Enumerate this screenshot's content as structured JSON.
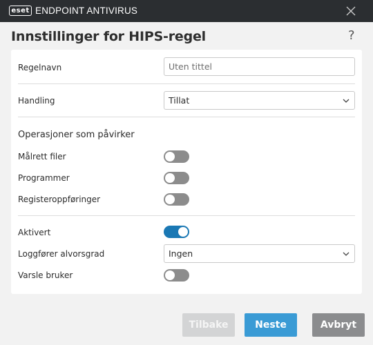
{
  "titlebar": {
    "logo_badge": "eset",
    "app_name": "ENDPOINT ANTIVIRUS"
  },
  "header": {
    "title": "Innstillinger for HIPS-regel",
    "help": "?"
  },
  "form": {
    "rule_name": {
      "label": "Regelnavn",
      "placeholder": "Uten tittel"
    },
    "action": {
      "label": "Handling",
      "value": "Tillat"
    },
    "operations_heading": "Operasjoner som påvirker",
    "target_files": {
      "label": "Målrett filer",
      "enabled": false
    },
    "applications": {
      "label": "Programmer",
      "enabled": false
    },
    "registry_entries": {
      "label": "Registeroppføringer",
      "enabled": false
    },
    "enabled": {
      "label": "Aktivert",
      "enabled": true
    },
    "logging_severity": {
      "label": "Loggfører alvorsgrad",
      "value": "Ingen"
    },
    "notify_user": {
      "label": "Varsle bruker",
      "enabled": false
    }
  },
  "footer": {
    "back": "Tilbake",
    "next": "Neste",
    "cancel": "Avbryt"
  },
  "colors": {
    "titlebar": "#2b2e31",
    "toggle_on": "#1a78b4",
    "toggle_off": "#8c8c8c",
    "primary_button": "#3a9bd5"
  }
}
